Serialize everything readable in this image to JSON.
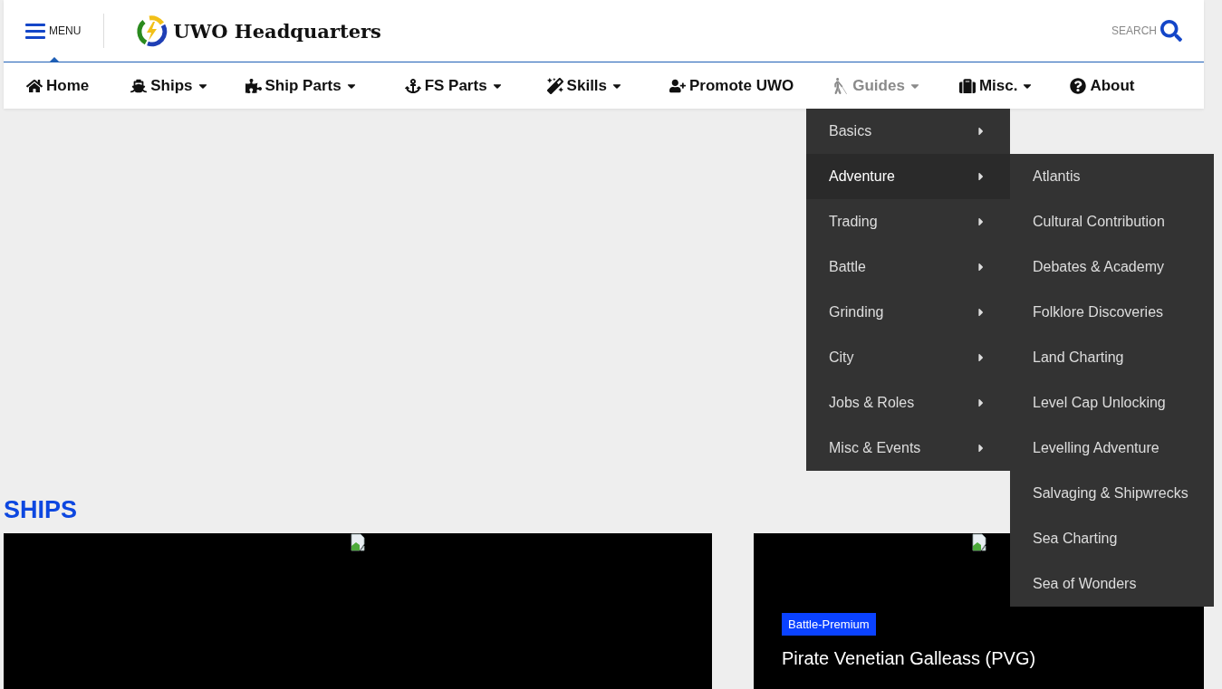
{
  "header": {
    "menu_label": "MENU",
    "site_title": "UWO Headquarters",
    "search_label": "SEARCH"
  },
  "nav": [
    {
      "label": "Home",
      "has_dropdown": false,
      "selected": false
    },
    {
      "label": "Ships",
      "has_dropdown": true,
      "selected": false
    },
    {
      "label": "Ship Parts",
      "has_dropdown": true,
      "selected": false
    },
    {
      "label": "FS Parts",
      "has_dropdown": true,
      "selected": false
    },
    {
      "label": "Skills",
      "has_dropdown": true,
      "selected": false
    },
    {
      "label": "Promote UWO",
      "has_dropdown": false,
      "selected": false
    },
    {
      "label": "Guides",
      "has_dropdown": true,
      "selected": true
    },
    {
      "label": "Misc.",
      "has_dropdown": true,
      "selected": false
    },
    {
      "label": "About",
      "has_dropdown": false,
      "selected": false
    }
  ],
  "dropdown": [
    {
      "label": "Basics",
      "selected": false
    },
    {
      "label": "Adventure",
      "selected": true
    },
    {
      "label": "Trading",
      "selected": false
    },
    {
      "label": "Battle",
      "selected": false
    },
    {
      "label": "Grinding",
      "selected": false
    },
    {
      "label": "City",
      "selected": false
    },
    {
      "label": "Jobs & Roles",
      "selected": false
    },
    {
      "label": "Misc & Events",
      "selected": false
    }
  ],
  "submenu": [
    "Atlantis",
    "Cultural Contribution",
    "Debates & Academy",
    "Folklore Discoveries",
    "Land Charting",
    "Level Cap Unlocking",
    "Levelling Adventure",
    "Salvaging & Shipwrecks",
    "Sea Charting",
    "Sea of Wonders"
  ],
  "section_title": "SHIPS",
  "cards": [
    {
      "kind": "plain"
    },
    {
      "kind": "captioned",
      "tag": "Battle-Premium",
      "title": "Pirate Venetian Galleass (PVG)"
    }
  ]
}
